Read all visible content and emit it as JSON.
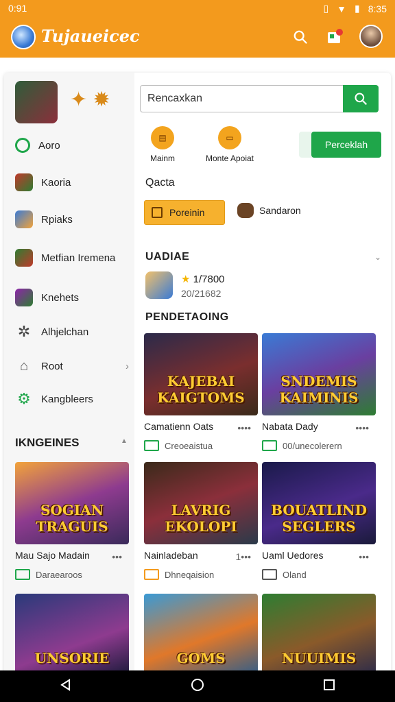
{
  "status_bar": {
    "time": "0:91",
    "right_time": "8:35"
  },
  "app_bar": {
    "title": "Tujaueicec"
  },
  "sidebar": {
    "items": [
      {
        "label": "Aoro"
      },
      {
        "label": "Kaoria"
      },
      {
        "label": "Rpiaks"
      },
      {
        "label": "Metfian Iremena"
      },
      {
        "label": "Knehets"
      },
      {
        "label": "Alhjelchan"
      },
      {
        "label": "Root"
      },
      {
        "label": "Kangbleers"
      }
    ],
    "section_title": "IKNGEINES"
  },
  "search": {
    "placeholder": "Rencaxkan"
  },
  "quick_actions": [
    {
      "label": "Mainm"
    },
    {
      "label": "Monte Apoiat"
    }
  ],
  "action_button": "Perceklah",
  "filter_label": "Qacta",
  "filters": [
    {
      "label": "Poreinin"
    },
    {
      "label": "Sandaron"
    }
  ],
  "updates": {
    "title": "UADIAE",
    "line1": "1/7800",
    "line2": "20/21682"
  },
  "pending": {
    "title": "PENDETAOING"
  },
  "games": [
    {
      "title": "KAJEBAI KAIGTOMS",
      "name": "Camatienn Oats",
      "sub": "Creoeaistua",
      "menu": "••••"
    },
    {
      "title": "SNDEMIS KAIMINIS",
      "name": "Nabata Dady",
      "sub": "00/unecolerern",
      "menu": "••••"
    },
    {
      "title": "SOGIAN TRAGUIS",
      "name": "Mau Sajo Madain",
      "sub": "Daraearoos",
      "menu": "•••"
    },
    {
      "title": "LAVRIG EKOLOPI",
      "name": "Nainladeban",
      "sub": "Dhneqaision",
      "menu": "1•••"
    },
    {
      "title": "BOUATLIND SEGLERS",
      "name": "Uaml Uedores",
      "sub": "Oland",
      "menu": "•••"
    },
    {
      "title": "UNSORIE",
      "name": "",
      "sub": "",
      "menu": ""
    },
    {
      "title": "GOMS",
      "name": "",
      "sub": "",
      "menu": ""
    },
    {
      "title": "NUUIMIS",
      "name": "",
      "sub": "",
      "menu": ""
    }
  ],
  "colors": {
    "accent": "#f39a1d",
    "green": "#1fa64a"
  }
}
